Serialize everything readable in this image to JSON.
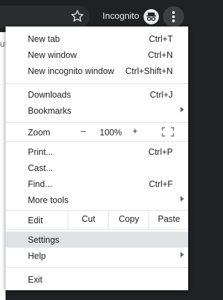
{
  "toolbar": {
    "incognito_label": "Incognito",
    "icons": [
      "star-icon",
      "incognito-icon",
      "more-vert-icon"
    ]
  },
  "background_page": {
    "text_fragment": "uf"
  },
  "menu": {
    "new_tab": {
      "label": "New tab",
      "shortcut": "Ctrl+T"
    },
    "new_window": {
      "label": "New window",
      "shortcut": "Ctrl+N"
    },
    "new_incognito_window": {
      "label": "New incognito window",
      "shortcut": "Ctrl+Shift+N"
    },
    "downloads": {
      "label": "Downloads",
      "shortcut": "Ctrl+J"
    },
    "bookmarks": {
      "label": "Bookmarks"
    },
    "zoom": {
      "label": "Zoom",
      "minus": "–",
      "value": "100%",
      "plus": "+"
    },
    "print": {
      "label": "Print...",
      "shortcut": "Ctrl+P"
    },
    "cast": {
      "label": "Cast..."
    },
    "find": {
      "label": "Find...",
      "shortcut": "Ctrl+F"
    },
    "more_tools": {
      "label": "More tools"
    },
    "edit": {
      "label": "Edit",
      "cut": "Cut",
      "copy": "Copy",
      "paste": "Paste"
    },
    "settings": {
      "label": "Settings"
    },
    "help": {
      "label": "Help"
    },
    "exit": {
      "label": "Exit"
    }
  },
  "colors": {
    "toolbar_bg": "#202124",
    "menu_bg": "#ffffff",
    "highlight": "#e1e2e4",
    "text": "#202124"
  }
}
